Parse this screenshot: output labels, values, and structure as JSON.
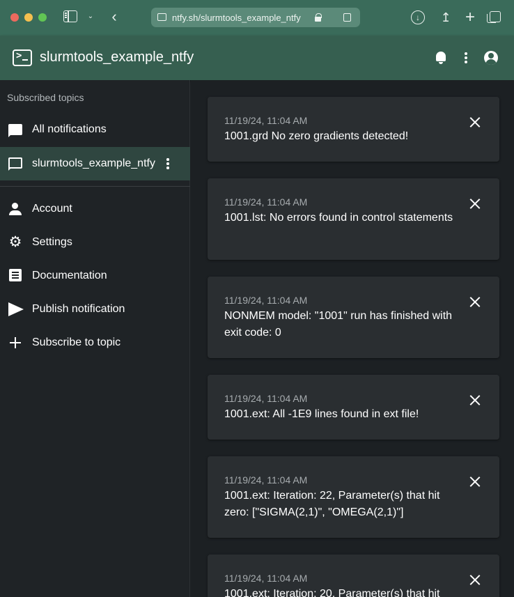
{
  "browser": {
    "url": "ntfy.sh/slurmtools_example_ntfy"
  },
  "appbar": {
    "title": "slurmtools_example_ntfy"
  },
  "sidebar": {
    "heading": "Subscribed topics",
    "topics": [
      {
        "label": "All notifications"
      },
      {
        "label": "slurmtools_example_ntfy"
      }
    ],
    "links": [
      {
        "label": "Account"
      },
      {
        "label": "Settings"
      },
      {
        "label": "Documentation"
      },
      {
        "label": "Publish notification"
      },
      {
        "label": "Subscribe to topic"
      }
    ]
  },
  "notifications": [
    {
      "time": "11/19/24, 11:04 AM",
      "message": "1001.grd No zero gradients detected!"
    },
    {
      "time": "11/19/24, 11:04 AM",
      "message": "1001.lst: No errors found in control statements"
    },
    {
      "time": "11/19/24, 11:04 AM",
      "message": "NONMEM model: \"1001\" run has finished with exit code: 0"
    },
    {
      "time": "11/19/24, 11:04 AM",
      "message": "1001.ext: All -1E9 lines found in ext file!"
    },
    {
      "time": "11/19/24, 11:04 AM",
      "message": "1001.ext: Iteration: 22, Parameter(s) that hit zero: [\"SIGMA(2,1)\", \"OMEGA(2,1)\"]"
    },
    {
      "time": "11/19/24, 11:04 AM",
      "message": "1001.ext: Iteration: 20, Parameter(s) that hit"
    }
  ],
  "colors": {
    "chrome": "#3a6b5a",
    "appbar": "#365f50",
    "sidebar": "#1f2326",
    "active_item": "#2f4640",
    "card": "#2a2e31"
  }
}
